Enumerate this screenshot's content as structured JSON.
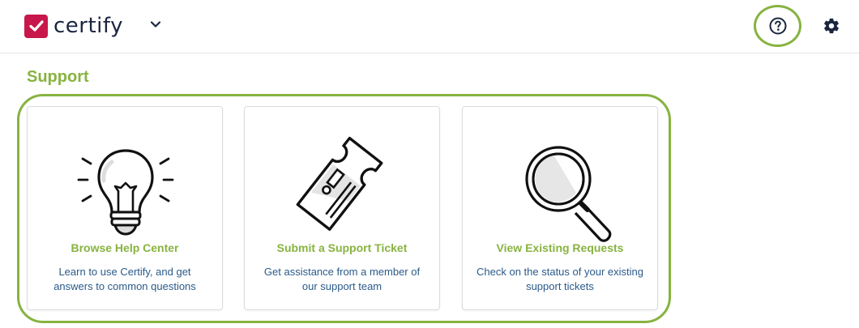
{
  "header": {
    "brand_name": "certify",
    "logo_icon": "checkmark-icon",
    "brand_color": "#c8174a",
    "help_icon": "question-circle-icon",
    "settings_icon": "gear-icon"
  },
  "page": {
    "title": "Support",
    "accent_color": "#87b340",
    "link_color": "#2a5a8a"
  },
  "cards": [
    {
      "icon": "lightbulb-icon",
      "title": "Browse Help Center",
      "description": "Learn to use Certify, and get answers to common questions"
    },
    {
      "icon": "ticket-icon",
      "title": "Submit a Support Ticket",
      "description": "Get assistance from a member of our support team"
    },
    {
      "icon": "magnifying-glass-icon",
      "title": "View Existing Requests",
      "description": "Check on the status of your existing support tickets"
    }
  ]
}
